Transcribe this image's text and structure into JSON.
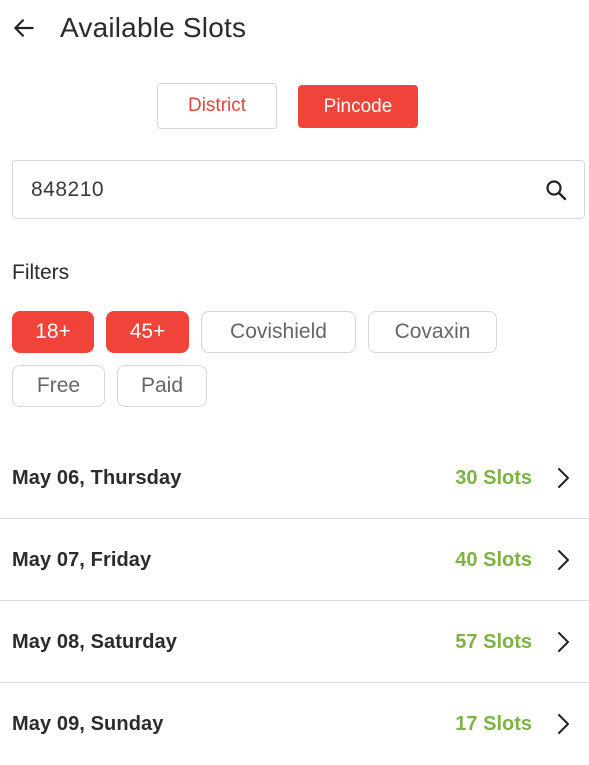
{
  "header": {
    "title": "Available Slots",
    "back_icon": "arrow-left-icon"
  },
  "toggle": {
    "district_label": "District",
    "pincode_label": "Pincode",
    "selected": "Pincode"
  },
  "search": {
    "value": "848210",
    "icon": "search-icon"
  },
  "filters": {
    "label": "Filters",
    "chips": [
      {
        "label": "18+",
        "active": true
      },
      {
        "label": "45+",
        "active": true
      },
      {
        "label": "Covishield",
        "active": false
      },
      {
        "label": "Covaxin",
        "active": false
      },
      {
        "label": "Free",
        "active": false
      },
      {
        "label": "Paid",
        "active": false
      }
    ]
  },
  "slots": [
    {
      "date": "May 06, Thursday",
      "slots": "30 Slots"
    },
    {
      "date": "May 07, Friday",
      "slots": "40 Slots"
    },
    {
      "date": "May 08, Saturday",
      "slots": "57 Slots"
    },
    {
      "date": "May 09, Sunday",
      "slots": "17 Slots"
    }
  ],
  "colors": {
    "accent": "#f0433a",
    "slots_green": "#7cb342"
  }
}
